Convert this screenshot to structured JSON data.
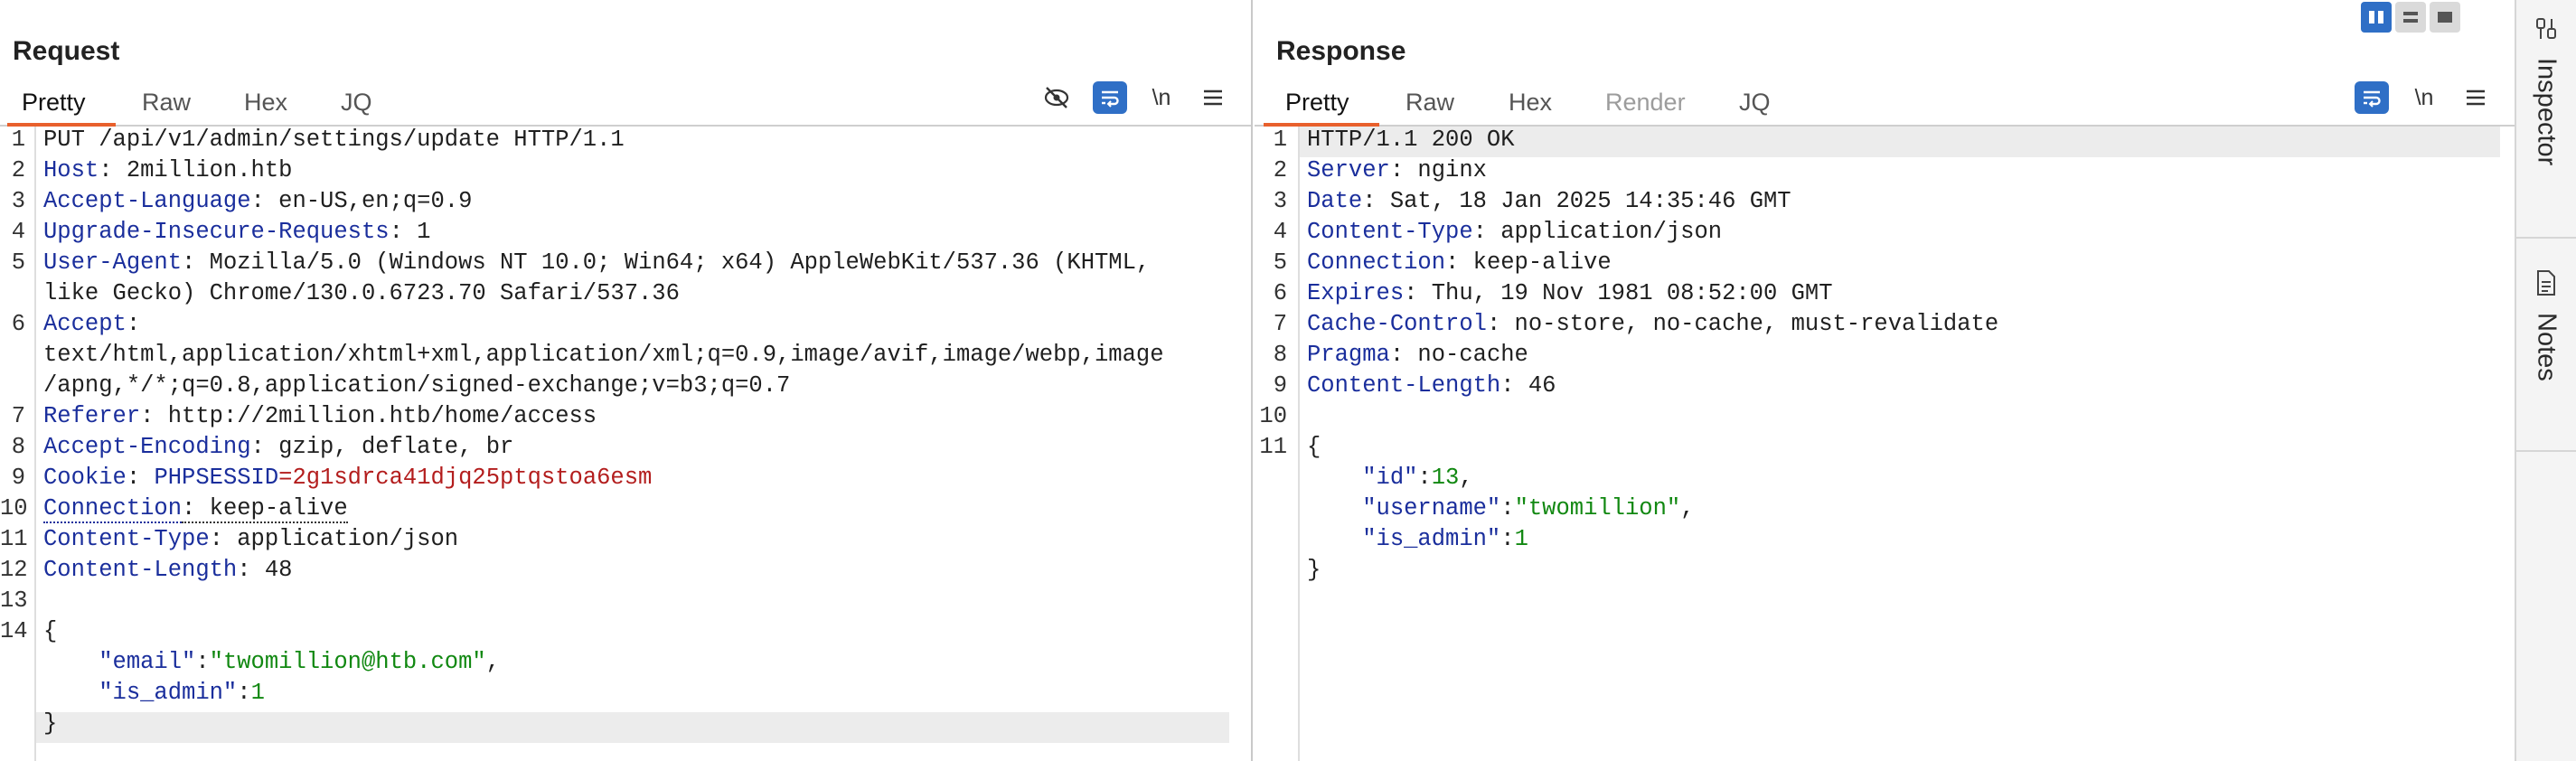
{
  "request": {
    "title": "Request",
    "tabs": [
      "Pretty",
      "Raw",
      "Hex",
      "JQ"
    ],
    "newline_label": "\\n",
    "lines": [
      {
        "no": "1",
        "segs": [
          {
            "t": "PUT /api/v1/admin/settings/update HTTP/1.1",
            "c": ""
          }
        ]
      },
      {
        "no": "2",
        "segs": [
          {
            "t": "Host",
            "c": "k"
          },
          {
            "t": ": 2million.htb",
            "c": ""
          }
        ]
      },
      {
        "no": "3",
        "segs": [
          {
            "t": "Accept-Language",
            "c": "k"
          },
          {
            "t": ": en-US,en;q=0.9",
            "c": ""
          }
        ]
      },
      {
        "no": "4",
        "segs": [
          {
            "t": "Upgrade-Insecure-Requests",
            "c": "k"
          },
          {
            "t": ": 1",
            "c": ""
          }
        ]
      },
      {
        "no": "5",
        "segs": [
          {
            "t": "User-Agent",
            "c": "k"
          },
          {
            "t": ": Mozilla/5.0 (Windows NT 10.0; Win64; x64) AppleWebKit/537.36 (KHTML,",
            "c": ""
          }
        ]
      },
      {
        "no": "",
        "segs": [
          {
            "t": "like Gecko) Chrome/130.0.6723.70 Safari/537.36",
            "c": ""
          }
        ]
      },
      {
        "no": "6",
        "segs": [
          {
            "t": "Accept",
            "c": "k"
          },
          {
            "t": ":",
            "c": ""
          }
        ]
      },
      {
        "no": "",
        "segs": [
          {
            "t": "text/html,application/xhtml+xml,application/xml;q=0.9,image/avif,image/webp,image",
            "c": ""
          }
        ]
      },
      {
        "no": "",
        "segs": [
          {
            "t": "/apng,*/*;q=0.8,application/signed-exchange;v=b3;q=0.7",
            "c": ""
          }
        ]
      },
      {
        "no": "7",
        "segs": [
          {
            "t": "Referer",
            "c": "k"
          },
          {
            "t": ": http://2million.htb/home/access",
            "c": ""
          }
        ]
      },
      {
        "no": "8",
        "segs": [
          {
            "t": "Accept-Encoding",
            "c": "k"
          },
          {
            "t": ": gzip, deflate, br",
            "c": ""
          }
        ]
      },
      {
        "no": "9",
        "segs": [
          {
            "t": "Cookie",
            "c": "k"
          },
          {
            "t": ": ",
            "c": ""
          },
          {
            "t": "PHPSESSID",
            "c": "k"
          },
          {
            "t": "=2g1sdrca41djq25ptqstoa6esm",
            "c": "c"
          }
        ]
      },
      {
        "no": "10",
        "segs": [
          {
            "t": "Connection",
            "c": "k"
          },
          {
            "t": ": keep-alive",
            "c": ""
          }
        ]
      },
      {
        "no": "11",
        "segs": [
          {
            "t": "Content-Type",
            "c": "k"
          },
          {
            "t": ": application/json",
            "c": ""
          }
        ]
      },
      {
        "no": "12",
        "segs": [
          {
            "t": "Content-Length",
            "c": "k"
          },
          {
            "t": ": 48",
            "c": ""
          }
        ]
      },
      {
        "no": "13",
        "segs": []
      },
      {
        "no": "14",
        "segs": [
          {
            "t": "{",
            "c": ""
          }
        ]
      },
      {
        "no": "",
        "segs": [
          {
            "t": "    \"email\"",
            "c": "k"
          },
          {
            "t": ":",
            "c": ""
          },
          {
            "t": "\"twomillion@htb.com\"",
            "c": "s"
          },
          {
            "t": ",",
            "c": ""
          }
        ]
      },
      {
        "no": "",
        "segs": [
          {
            "t": "    \"is_admin\"",
            "c": "k"
          },
          {
            "t": ":",
            "c": ""
          },
          {
            "t": "1",
            "c": "n"
          }
        ]
      },
      {
        "no": "",
        "segs": [
          {
            "t": "}",
            "c": ""
          }
        ]
      }
    ]
  },
  "response": {
    "title": "Response",
    "tabs": [
      "Pretty",
      "Raw",
      "Hex",
      "Render",
      "JQ"
    ],
    "newline_label": "\\n",
    "lines": [
      {
        "no": "1",
        "segs": [
          {
            "t": "HTTP/1.1 200 OK",
            "c": ""
          }
        ]
      },
      {
        "no": "2",
        "segs": [
          {
            "t": "Server",
            "c": "k"
          },
          {
            "t": ": nginx",
            "c": ""
          }
        ]
      },
      {
        "no": "3",
        "segs": [
          {
            "t": "Date",
            "c": "k"
          },
          {
            "t": ": Sat, 18 Jan 2025 14:35:46 GMT",
            "c": ""
          }
        ]
      },
      {
        "no": "4",
        "segs": [
          {
            "t": "Content-Type",
            "c": "k"
          },
          {
            "t": ": application/json",
            "c": ""
          }
        ]
      },
      {
        "no": "5",
        "segs": [
          {
            "t": "Connection",
            "c": "k"
          },
          {
            "t": ": keep-alive",
            "c": ""
          }
        ]
      },
      {
        "no": "6",
        "segs": [
          {
            "t": "Expires",
            "c": "k"
          },
          {
            "t": ": Thu, 19 Nov 1981 08:52:00 GMT",
            "c": ""
          }
        ]
      },
      {
        "no": "7",
        "segs": [
          {
            "t": "Cache-Control",
            "c": "k"
          },
          {
            "t": ": no-store, no-cache, must-revalidate",
            "c": ""
          }
        ]
      },
      {
        "no": "8",
        "segs": [
          {
            "t": "Pragma",
            "c": "k"
          },
          {
            "t": ": no-cache",
            "c": ""
          }
        ]
      },
      {
        "no": "9",
        "segs": [
          {
            "t": "Content-Length",
            "c": "k"
          },
          {
            "t": ": 46",
            "c": ""
          }
        ]
      },
      {
        "no": "10",
        "segs": []
      },
      {
        "no": "11",
        "segs": [
          {
            "t": "{",
            "c": ""
          }
        ]
      },
      {
        "no": "",
        "segs": [
          {
            "t": "    \"id\"",
            "c": "k"
          },
          {
            "t": ":",
            "c": ""
          },
          {
            "t": "13",
            "c": "n"
          },
          {
            "t": ",",
            "c": ""
          }
        ]
      },
      {
        "no": "",
        "segs": [
          {
            "t": "    \"username\"",
            "c": "k"
          },
          {
            "t": ":",
            "c": ""
          },
          {
            "t": "\"twomillion\"",
            "c": "s"
          },
          {
            "t": ",",
            "c": ""
          }
        ]
      },
      {
        "no": "",
        "segs": [
          {
            "t": "    \"is_admin\"",
            "c": "k"
          },
          {
            "t": ":",
            "c": ""
          },
          {
            "t": "1",
            "c": "n"
          }
        ]
      },
      {
        "no": "",
        "segs": [
          {
            "t": "}",
            "c": ""
          }
        ]
      }
    ]
  },
  "sidebar": {
    "inspector_label": "Inspector",
    "notes_label": "Notes"
  },
  "colors": {
    "accent": "#e8602c",
    "toggle_blue": "#2f6fc6",
    "header_key": "#1a2e9c",
    "json_string": "#118811",
    "cookie_value": "#b31d1d"
  }
}
